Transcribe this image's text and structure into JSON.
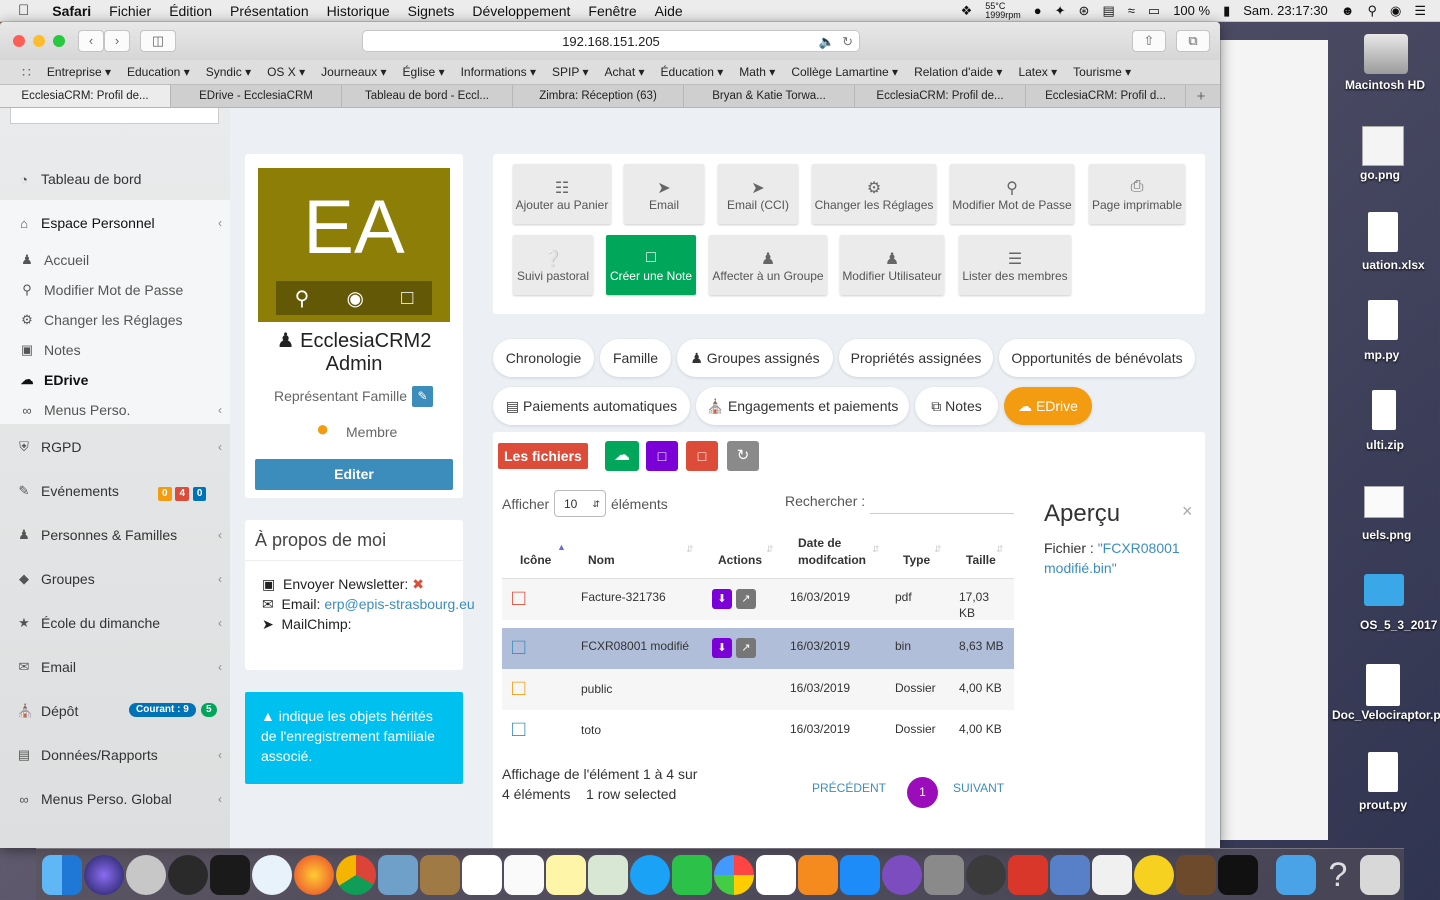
{
  "menubar": {
    "app": "Safari",
    "items": [
      "Fichier",
      "Édition",
      "Présentation",
      "Historique",
      "Signets",
      "Développement",
      "Fenêtre",
      "Aide"
    ],
    "temp": "55°C",
    "rpm": "1999rpm",
    "battery": "100 %",
    "clock": "Sam. 23:17:30"
  },
  "browser": {
    "url": "192.168.151.205",
    "bookmarks": [
      "Entreprise ▾",
      "Education ▾",
      "Syndic ▾",
      "OS X ▾",
      "Journeaux ▾",
      "Église ▾",
      "Informations ▾",
      "SPIP ▾",
      "Achat ▾",
      "Éducation ▾",
      "Math ▾",
      "Collège Lamartine ▾",
      "Relation d'aide ▾",
      "Latex ▾",
      "Tourisme ▾"
    ],
    "tabs": [
      "EcclesiaCRM: Profil de...",
      "EDrive - EcclesiaCRM",
      "Tableau de bord - Eccl...",
      "Zimbra: Réception (63)",
      "Bryan & Katie Torwa...",
      "EcclesiaCRM: Profil de...",
      "EcclesiaCRM: Profil d..."
    ]
  },
  "sidebar": {
    "dashboard": "Tableau de bord",
    "personal_space": "Espace Personnel",
    "sub": [
      "Accueil",
      "Modifier Mot de Passe",
      "Changer les Réglages",
      "Notes",
      "EDrive",
      "Menus Perso."
    ],
    "sections": [
      "RGPD",
      "Evénements",
      "Personnes & Familles",
      "Groupes",
      "École du dimanche",
      "Email",
      "Dépôt",
      "Données/Rapports",
      "Menus Perso. Global"
    ],
    "events_badges": [
      "0",
      "4",
      "0"
    ],
    "deposit_badge": "Courant : 9",
    "deposit_count": "5"
  },
  "profile": {
    "initials": "EA",
    "name": "EcclesiaCRM2 Admin",
    "role": "Représentant Famille",
    "status": "Membre",
    "edit_label": "Editer",
    "about_title": "À propos de moi",
    "newsletter_label": "Envoyer Newsletter:",
    "email_label": "Email:",
    "email_value": "erp@epis-strasbourg.eu",
    "mailchimp_label": "MailChimp:",
    "info_note": "indique les objets hérités de l'enregistrement familiale associé."
  },
  "actions": {
    "row1": [
      "Ajouter au Panier",
      "Email",
      "Email (CCI)",
      "Changer les Réglages",
      "Modifier Mot de Passe",
      "Page imprimable"
    ],
    "row2": [
      "Suivi pastoral",
      "Créer une Note",
      "Affecter à un Groupe",
      "Modifier Utilisateur",
      "Lister des membres"
    ]
  },
  "tabs_nav": [
    "Chronologie",
    "Famille",
    "Groupes assignés",
    "Propriétés assignées",
    "Opportunités de bénévolats",
    "Paiements automatiques",
    "Engagements et paiements",
    "Notes",
    "EDrive"
  ],
  "edrive": {
    "files_label": "Les fichiers",
    "show_label": "Afficher",
    "show_value": "10",
    "elements_label": "éléments",
    "search_label": "Rechercher :",
    "columns": [
      "Icône",
      "Nom",
      "Actions",
      "Date de modifcation",
      "Type",
      "Taille"
    ],
    "rows": [
      {
        "name": "Facture-321736",
        "date": "16/03/2019",
        "type": "pdf",
        "size": "17,03 KB"
      },
      {
        "name": "FCXR08001 modifié",
        "date": "16/03/2019",
        "type": "bin",
        "size": "8,63 MB"
      },
      {
        "name": "public",
        "date": "16/03/2019",
        "type": "Dossier",
        "size": "4,00 KB"
      },
      {
        "name": "toto",
        "date": "16/03/2019",
        "type": "Dossier",
        "size": "4,00 KB"
      }
    ],
    "info_line1": "Affichage de l'élément 1 à 4 sur",
    "info_line2": "4 éléments",
    "selected": "1 row selected",
    "prev": "PRÉCÉDENT",
    "page": "1",
    "next": "SUIVANT",
    "preview_title": "Aperçu",
    "preview_label": "Fichier :",
    "preview_file": "\"FCXR08001 modifié.bin\""
  },
  "desktop": {
    "items": [
      "Macintosh HD",
      "go.png",
      "uation.xlsx",
      "mp.py",
      "ulti.zip",
      "uels.png",
      "OS_5_3_2017",
      "Doc_Velociraptor.pdf",
      "prout.py"
    ]
  },
  "colors": {
    "avatar": "#8d7e08",
    "primary": "#3c8dbc",
    "success": "#00a65a",
    "danger": "#dd4b39",
    "warning": "#f39c12",
    "purple": "#7b00d8",
    "info": "#00c0ef"
  }
}
